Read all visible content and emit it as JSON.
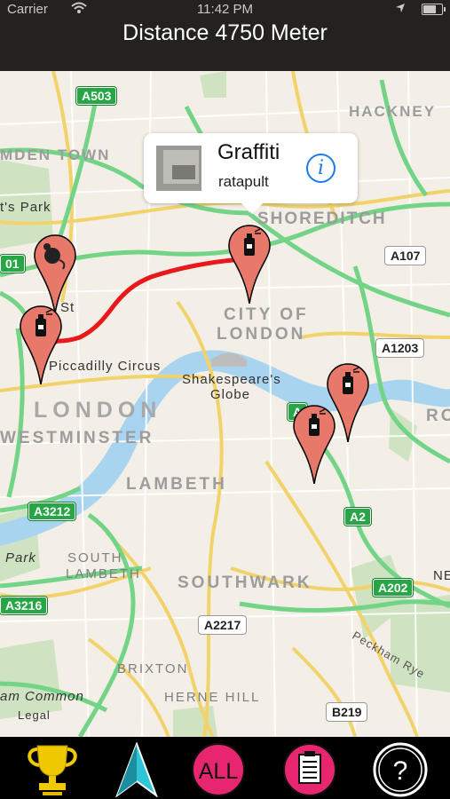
{
  "status_bar": {
    "carrier": "Carrier",
    "time": "11:42 PM"
  },
  "header": {
    "title": "Distance 4750 Meter"
  },
  "callout": {
    "title": "Graffiti",
    "subtitle": "ratapult"
  },
  "map": {
    "places": {
      "hackney": "HACKNEY",
      "camden": "MDEN TOWN",
      "regents_park": "t's Park",
      "shoreditch": "SHOREDITCH",
      "city_of_london_1": "CITY OF",
      "city_of_london_2": "LONDON",
      "london": "LONDON",
      "westminster": "WESTMINSTER",
      "lambeth": "LAMBETH",
      "south_lambeth_1": "SOUTH",
      "south_lambeth_2": "LAMBETH",
      "southwark": "SOUTHWARK",
      "brixton": "BRIXTON",
      "herne_hill": "HERNE HILL",
      "piccadilly": "Piccadilly Circus",
      "oxford_st": "St",
      "shakespeares_globe_1": "Shakespeare's",
      "shakespeares_globe_2": "Globe",
      "park": "Park",
      "clapham": "am Common",
      "peckham_rye": "Peckham Rye",
      "legal": "Legal",
      "ro": "RO",
      "ne": "NE"
    },
    "roads": {
      "a503": "A503",
      "a515": "B515",
      "a107": "A107",
      "a1203": "A1203",
      "a01": "01",
      "a3212": "A3212",
      "a2": "A2",
      "a202": "A202",
      "a3216": "A3216",
      "a2217": "A2217",
      "b219": "B219",
      "a_partial": "A"
    }
  },
  "tabs": [
    "trophy",
    "navigation",
    "all",
    "list",
    "help"
  ],
  "tab_labels": {
    "all": "ALL"
  },
  "colors": {
    "pin": "#e8786a",
    "route": "#e8181b",
    "tab_pink": "#e8266f",
    "trophy": "#f0c800",
    "nav": "#2ec5d8"
  }
}
